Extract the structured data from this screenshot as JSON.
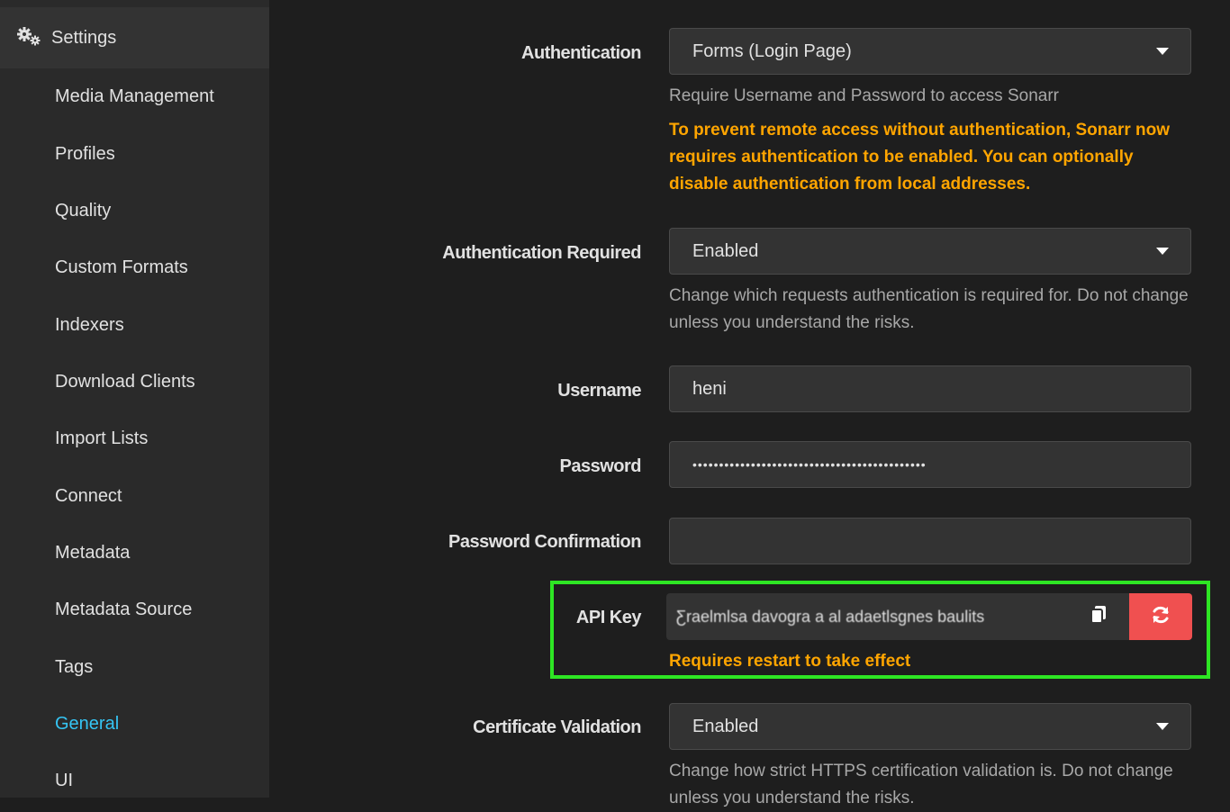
{
  "sidebar": {
    "header_label": "Settings",
    "header_icon": "gears-icon",
    "items": [
      {
        "label": "Media Management"
      },
      {
        "label": "Profiles"
      },
      {
        "label": "Quality"
      },
      {
        "label": "Custom Formats"
      },
      {
        "label": "Indexers"
      },
      {
        "label": "Download Clients"
      },
      {
        "label": "Import Lists"
      },
      {
        "label": "Connect"
      },
      {
        "label": "Metadata"
      },
      {
        "label": "Metadata Source"
      },
      {
        "label": "Tags"
      },
      {
        "label": "General",
        "active": true
      },
      {
        "label": "UI"
      }
    ]
  },
  "form": {
    "authentication": {
      "label": "Authentication",
      "value": "Forms (Login Page)",
      "help": "Require Username and Password to access Sonarr",
      "warning": "To prevent remote access without authentication, Sonarr now requires authentication to be enabled. You can optionally disable authentication from local addresses."
    },
    "authentication_required": {
      "label": "Authentication Required",
      "value": "Enabled",
      "help": "Change which requests authentication is required for. Do not change unless you understand the risks."
    },
    "username": {
      "label": "Username",
      "value": "heni"
    },
    "password": {
      "label": "Password",
      "value": "••••••••••••••••••••••••••••••••••••••••••••"
    },
    "password_confirmation": {
      "label": "Password Confirmation",
      "value": ""
    },
    "api_key": {
      "label": "API Key",
      "value": "Ƹraelmlsa davogra a al adaetlsgnes baulits",
      "warning": "Requires restart to take effect"
    },
    "certificate_validation": {
      "label": "Certificate Validation",
      "value": "Enabled",
      "help": "Change how strict HTTPS certification validation is. Do not change unless you understand the risks."
    }
  },
  "colors": {
    "accent": "#35c5f4",
    "warning": "#ffa500",
    "danger": "#f05050",
    "highlight": "#2ee624"
  }
}
